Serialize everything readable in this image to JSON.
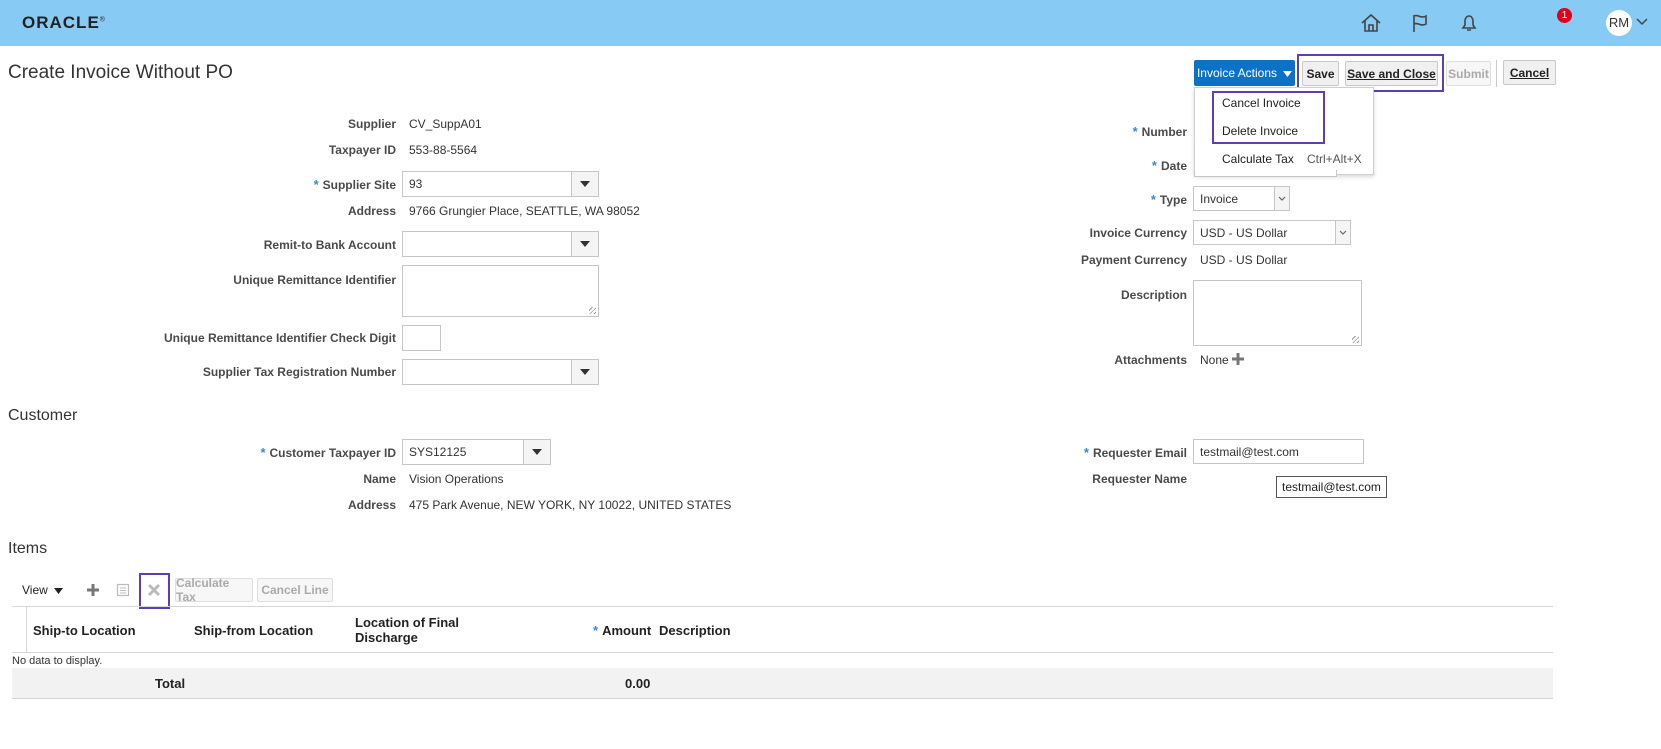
{
  "brand": "ORACLE",
  "header": {
    "notifications_count": "1",
    "user_initials": "RM",
    "icons": [
      "home-icon",
      "flag-icon",
      "bell-icon"
    ]
  },
  "page_title": "Create Invoice Without PO",
  "toolbar": {
    "invoice_actions": "Invoice Actions",
    "save": "Save",
    "save_and_close": "Save and Close",
    "submit": "Submit",
    "cancel": "Cancel"
  },
  "actions_menu": {
    "cancel_invoice": "Cancel Invoice",
    "delete_invoice": "Delete Invoice",
    "calculate_tax": "Calculate Tax",
    "calculate_tax_shortcut": "Ctrl+Alt+X"
  },
  "supplier": {
    "supplier_label": "Supplier",
    "supplier_value": "CV_SuppA01",
    "taxpayer_label": "Taxpayer ID",
    "taxpayer_value": "553-88-5564",
    "site_label": "Supplier Site",
    "site_value": "93",
    "address_label": "Address",
    "address_value": "9766 Grungier Place, SEATTLE, WA 98052",
    "remit_label": "Remit-to Bank Account",
    "remit_value": "",
    "uri_label": "Unique Remittance Identifier",
    "uri_check_label": "Unique Remittance Identifier Check Digit",
    "tax_reg_label": "Supplier Tax Registration Number"
  },
  "invoice": {
    "number_label": "Number",
    "date_label": "Date",
    "type_label": "Type",
    "type_value": "Invoice",
    "currency_label": "Invoice Currency",
    "currency_value": "USD - US Dollar",
    "payment_currency_label": "Payment Currency",
    "payment_currency_value": "USD - US Dollar",
    "description_label": "Description",
    "attachments_label": "Attachments",
    "attachments_value": "None"
  },
  "customer": {
    "section_title": "Customer",
    "taxpayer_label": "Customer Taxpayer ID",
    "taxpayer_value": "SYS12125",
    "name_label": "Name",
    "name_value": "Vision Operations",
    "address_label": "Address",
    "address_value": "475 Park Avenue, NEW YORK, NY 10022, UNITED STATES",
    "requester_email_label": "Requester Email",
    "requester_email_value": "testmail@test.com",
    "requester_name_label": "Requester Name",
    "tooltip": "testmail@test.com"
  },
  "items": {
    "section_title": "Items",
    "view": "View",
    "calculate_tax": "Calculate Tax",
    "cancel_line": "Cancel Line",
    "columns": {
      "ship_to": "Ship-to Location",
      "ship_from": "Ship-from Location",
      "final_discharge_1": "Location of Final",
      "final_discharge_2": "Discharge",
      "amount": "Amount",
      "description": "Description"
    },
    "empty_text": "No data to display.",
    "total_label": "Total",
    "total_value": "0.00"
  }
}
